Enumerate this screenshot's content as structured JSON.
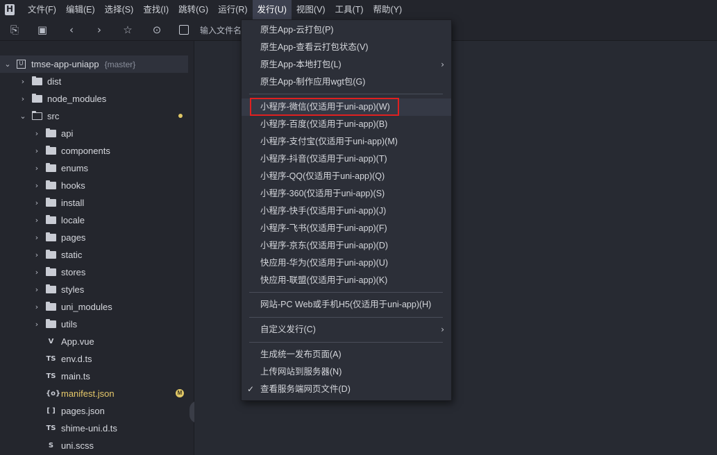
{
  "menubar": {
    "items": [
      "文件(F)",
      "编辑(E)",
      "选择(S)",
      "查找(I)",
      "跳转(G)",
      "运行(R)",
      "发行(U)",
      "视图(V)",
      "工具(T)",
      "帮助(Y)"
    ],
    "active_index": 6
  },
  "toolbar": {
    "search_placeholder": "输入文件名"
  },
  "project": {
    "name": "tmse-app-uniapp",
    "branch": "{master}"
  },
  "tree": [
    {
      "label": "dist",
      "type": "folder"
    },
    {
      "label": "node_modules",
      "type": "folder"
    },
    {
      "label": "src",
      "type": "folder-open"
    },
    {
      "label": "api",
      "type": "folder"
    },
    {
      "label": "components",
      "type": "folder"
    },
    {
      "label": "enums",
      "type": "folder"
    },
    {
      "label": "hooks",
      "type": "folder"
    },
    {
      "label": "install",
      "type": "folder"
    },
    {
      "label": "locale",
      "type": "folder"
    },
    {
      "label": "pages",
      "type": "folder"
    },
    {
      "label": "static",
      "type": "folder"
    },
    {
      "label": "stores",
      "type": "folder"
    },
    {
      "label": "styles",
      "type": "folder"
    },
    {
      "label": "uni_modules",
      "type": "folder"
    },
    {
      "label": "utils",
      "type": "folder"
    },
    {
      "label": "App.vue",
      "type": "file",
      "icon": "V"
    },
    {
      "label": "env.d.ts",
      "type": "file",
      "icon": "TS"
    },
    {
      "label": "main.ts",
      "type": "file",
      "icon": "TS"
    },
    {
      "label": "manifest.json",
      "type": "file",
      "icon": "{o}",
      "badge": "M"
    },
    {
      "label": "pages.json",
      "type": "file",
      "icon": "[ ]"
    },
    {
      "label": "shime-uni.d.ts",
      "type": "file",
      "icon": "TS"
    },
    {
      "label": "uni.scss",
      "type": "file",
      "icon": "S"
    }
  ],
  "dropdown": {
    "group1": [
      "原生App-云打包(P)",
      "原生App-查看云打包状态(V)",
      "原生App-本地打包(L)",
      "原生App-制作应用wgt包(G)"
    ],
    "group2": [
      "小程序-微信(仅适用于uni-app)(W)",
      "小程序-百度(仅适用于uni-app)(B)",
      "小程序-支付宝(仅适用于uni-app)(M)",
      "小程序-抖音(仅适用于uni-app)(T)",
      "小程序-QQ(仅适用于uni-app)(Q)",
      "小程序-360(仅适用于uni-app)(S)",
      "小程序-快手(仅适用于uni-app)(J)",
      "小程序-飞书(仅适用于uni-app)(F)",
      "小程序-京东(仅适用于uni-app)(D)",
      "快应用-华为(仅适用于uni-app)(U)",
      "快应用-联盟(仅适用于uni-app)(K)"
    ],
    "group3": [
      "网站-PC Web或手机H5(仅适用于uni-app)(H)"
    ],
    "group4": [
      "自定义发行(C)"
    ],
    "group5": [
      "生成统一发布页面(A)",
      "上传网站到服务器(N)",
      "查看服务端网页文件(D)"
    ],
    "highlight_color": "#e02020"
  }
}
